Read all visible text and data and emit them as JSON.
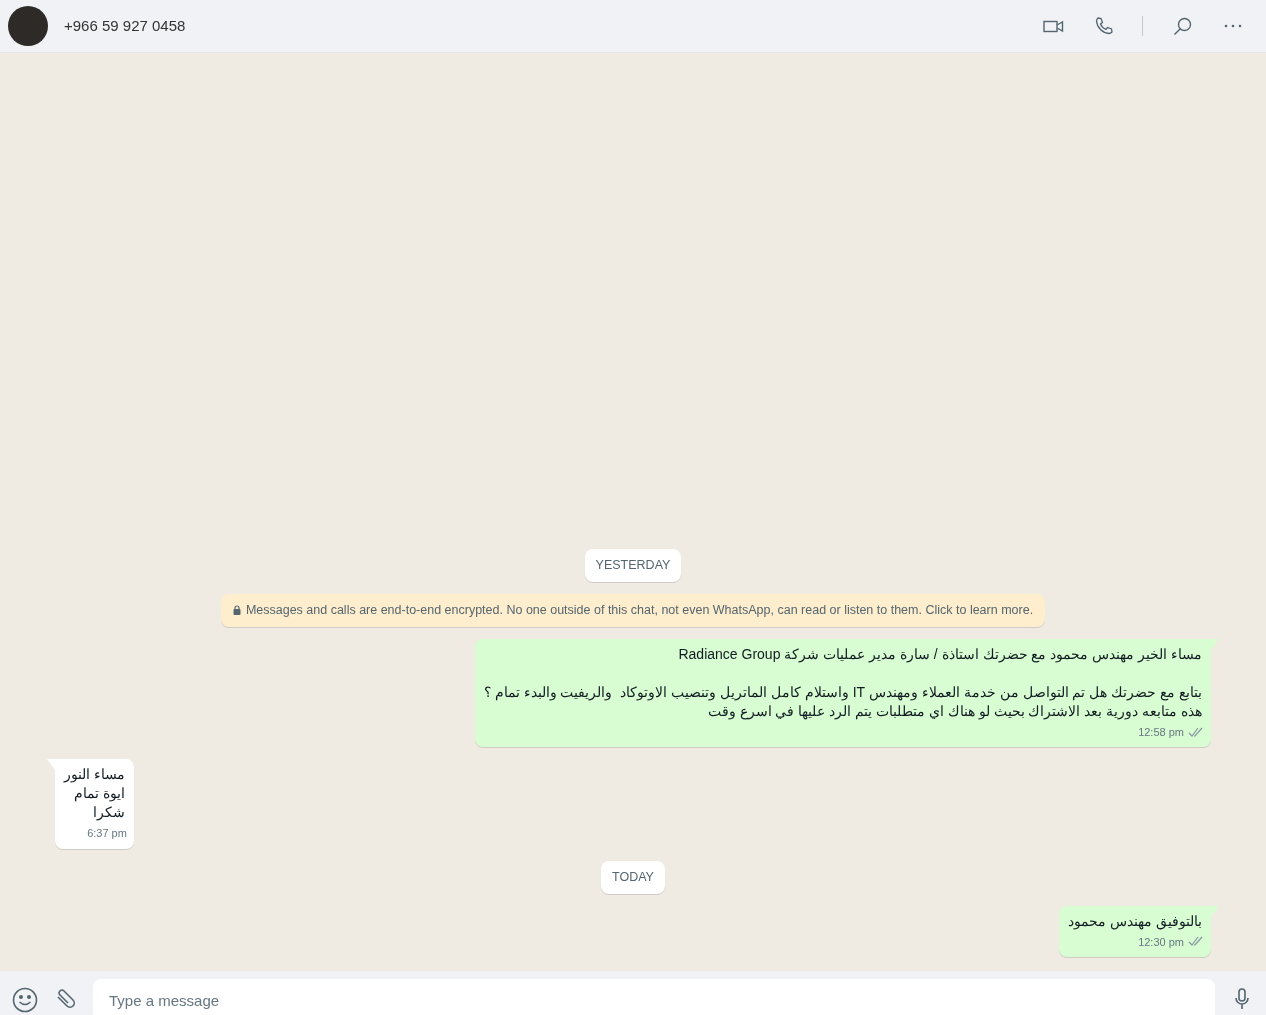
{
  "header": {
    "contact": "+966 59 927 0458"
  },
  "messages": [
    {
      "kind": "date",
      "text": "YESTERDAY"
    },
    {
      "kind": "notice",
      "text": "Messages and calls are end-to-end encrypted. No one outside of this chat, not even WhatsApp, can read or listen to them. Click to learn more."
    },
    {
      "kind": "out",
      "text": "مساء الخير مهندس محمود مع حضرتك استاذة / سارة مدير عمليات شركة Radiance Group\n\nبتابع مع حضرتك هل تم التواصل من خدمة العملاء ومهندس IT واستلام كامل الماتريل وتنصيب الاوتوكاد  والريفيت والبدء تمام ؟\nهذه متابعه دورية بعد الاشتراك بحيث لو هناك اي متطلبات يتم الرد عليها في اسرع وقت",
      "time": "12:58 pm",
      "read": false
    },
    {
      "kind": "in",
      "text": "مساء النور\nايوة تمام\nشكرا",
      "time": "6:37 pm"
    },
    {
      "kind": "date",
      "text": "TODAY"
    },
    {
      "kind": "out",
      "text": "بالتوفيق مهندس محمود",
      "time": "12:30 pm",
      "read": false
    }
  ],
  "composer": {
    "placeholder": "Type a message"
  }
}
